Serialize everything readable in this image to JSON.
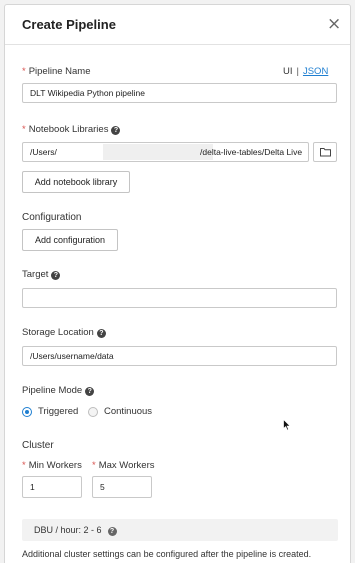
{
  "dialog": {
    "title": "Create Pipeline",
    "close_symbol": "×"
  },
  "pipeline_name": {
    "label": "Pipeline Name",
    "required_mark": "*",
    "value": "DLT Wikipedia Python pipeline"
  },
  "view_toggle": {
    "ui_label": "UI",
    "separator": "|",
    "json_label": "JSON",
    "link_color": "#1f7fd1"
  },
  "notebook_libraries": {
    "label": "Notebook Libraries",
    "required_mark": "*",
    "help_symbol": "?",
    "path_start": "/Users/",
    "path_end": "/delta-live-tables/Delta Live",
    "browse_icon": "folder-icon",
    "add_button": "Add notebook library"
  },
  "configuration": {
    "label": "Configuration",
    "add_button": "Add configuration"
  },
  "target": {
    "label": "Target",
    "help_symbol": "?",
    "value": ""
  },
  "storage_location": {
    "label": "Storage Location",
    "help_symbol": "?",
    "value": "/Users/username/data"
  },
  "pipeline_mode": {
    "label": "Pipeline Mode",
    "help_symbol": "?",
    "options": [
      {
        "label": "Triggered",
        "selected": true
      },
      {
        "label": "Continuous",
        "selected": false
      }
    ]
  },
  "cluster": {
    "label": "Cluster",
    "min_workers": {
      "label": "Min Workers",
      "required_mark": "*",
      "value": "1"
    },
    "max_workers": {
      "label": "Max Workers",
      "required_mark": "*",
      "value": "5"
    },
    "dbu_text": "DBU / hour: 2 - 6",
    "dbu_help_symbol": "?",
    "note": "Additional cluster settings can be configured after the pipeline is created."
  },
  "colors": {
    "required": "#d9534f",
    "accent": "#1f7fd1"
  }
}
